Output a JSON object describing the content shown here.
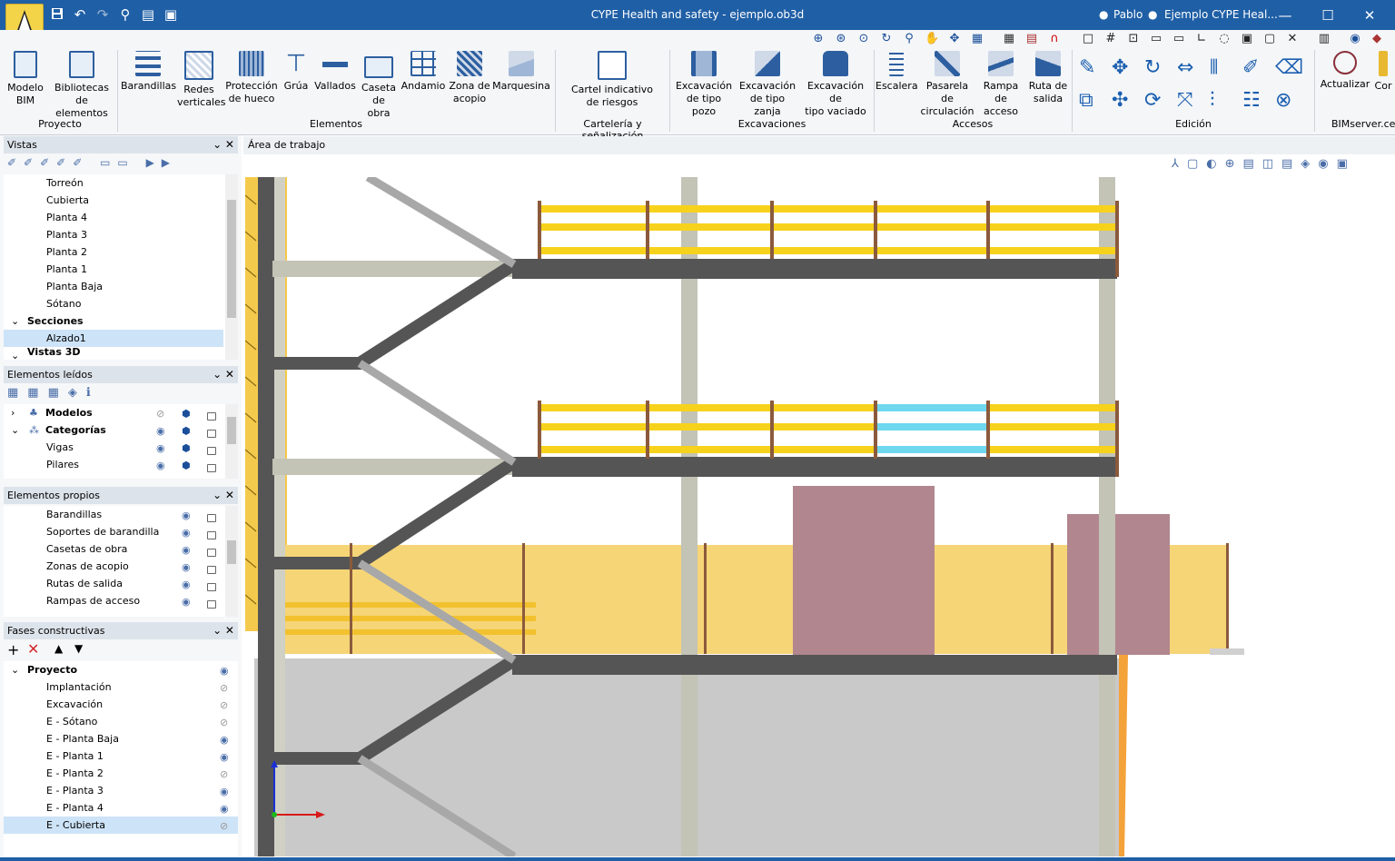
{
  "window": {
    "title": "CYPE Health and safety - ejemplo.ob3d",
    "user": "Pablo",
    "project_name": "Ejemplo CYPE Heal..."
  },
  "ribbon": {
    "groups": [
      {
        "label": "Proyecto",
        "buttons": [
          "Modelo\nBIM",
          "Bibliotecas\nde elementos"
        ]
      },
      {
        "label": "Elementos",
        "buttons": [
          "Barandillas",
          "Redes\nverticales",
          "Protección\nde hueco",
          "Grúa",
          "Vallados",
          "Caseta\nde obra",
          "Andamio",
          "Zona de\nacopio",
          "Marquesina"
        ]
      },
      {
        "label": "Cartelería y señalización",
        "buttons": [
          "Cartel indicativo\nde riesgos"
        ]
      },
      {
        "label": "Excavaciones",
        "buttons": [
          "Excavación\nde tipo pozo",
          "Excavación\nde tipo zanja",
          "Excavación de\ntipo vaciado"
        ]
      },
      {
        "label": "Accesos",
        "buttons": [
          "Escalera",
          "Pasarela de\ncirculación",
          "Rampa\nde acceso",
          "Ruta de\nsalida"
        ]
      },
      {
        "label": "Edición",
        "buttons": []
      },
      {
        "label": "BIMserver.ce",
        "buttons": [
          "Actualizar",
          "Cor"
        ]
      }
    ]
  },
  "panels": {
    "vistas": {
      "title": "Vistas",
      "items": [
        "Torreón",
        "Cubierta",
        "Planta 4",
        "Planta 3",
        "Planta 2",
        "Planta 1",
        "Planta Baja",
        "Sótano"
      ],
      "section_label": "Secciones",
      "section_item": "Alzado1",
      "partial": "Vistas 3D"
    },
    "leidos": {
      "title": "Elementos leídos",
      "models": "Modelos",
      "categories": "Categorías",
      "items": [
        "Vigas",
        "Pilares"
      ]
    },
    "propios": {
      "title": "Elementos propios",
      "items": [
        "Barandillas",
        "Soportes de barandilla",
        "Casetas de obra",
        "Zonas de acopio",
        "Rutas de salida",
        "Rampas de acceso"
      ]
    },
    "fases": {
      "title": "Fases constructivas",
      "root": "Proyecto",
      "items": [
        "Implantación",
        "Excavación",
        "E - Sótano",
        "E - Planta Baja",
        "E - Planta 1",
        "E - Planta 2",
        "E - Planta 3",
        "E - Planta 4",
        "E - Cubierta"
      ]
    }
  },
  "workarea": {
    "title": "Área de trabajo"
  },
  "icons": {
    "close": "✕",
    "collapse": "⌄"
  }
}
